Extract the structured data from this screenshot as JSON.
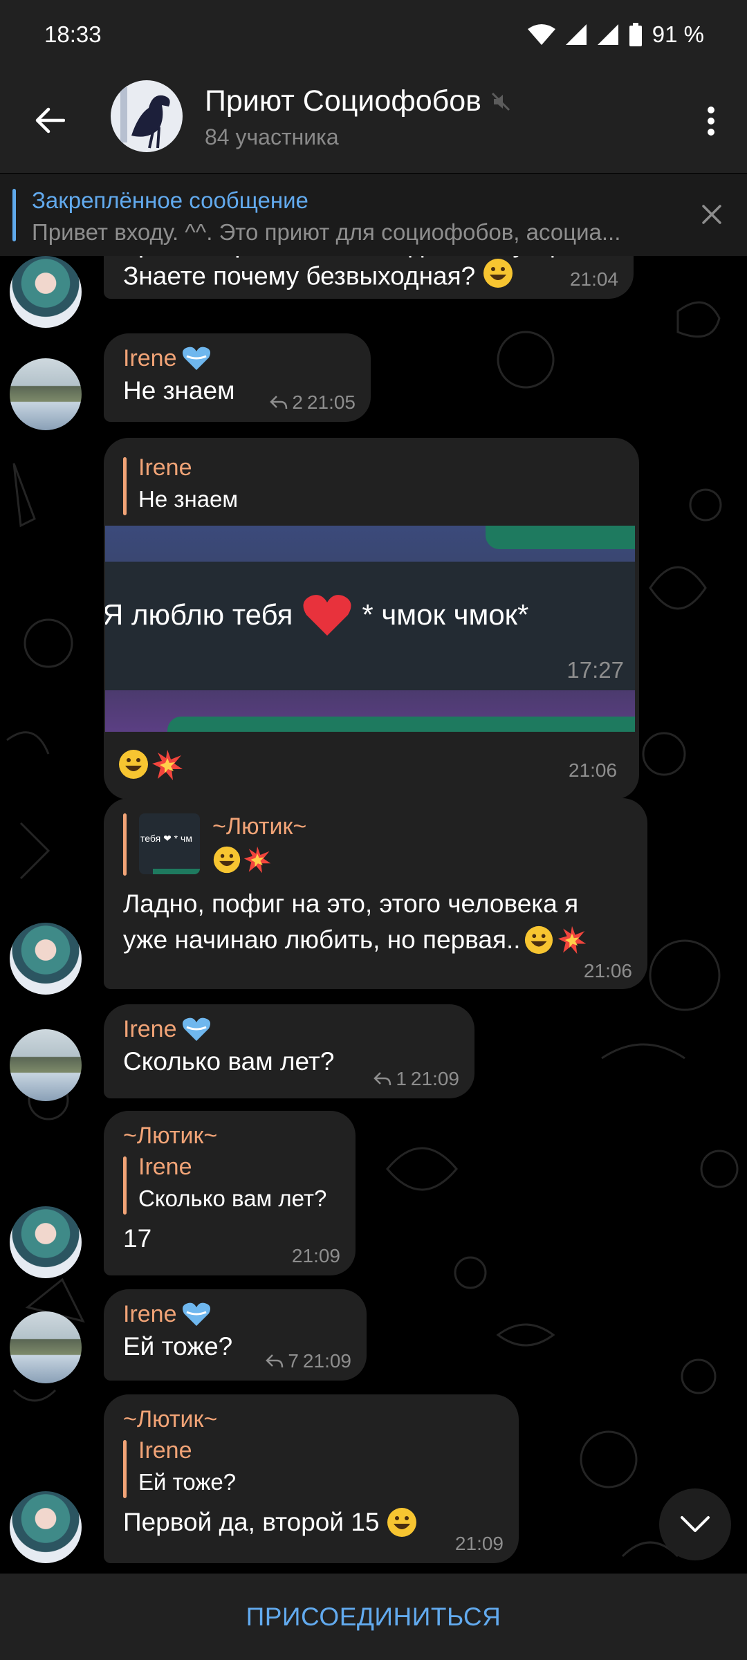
{
  "status_bar": {
    "time": "18:33",
    "battery": "91 %"
  },
  "header": {
    "title": "Приют Социофобов",
    "subtitle": "84 участника"
  },
  "pinned": {
    "title": "Закреплённое сообщение",
    "text": "Привет входу. ^^. Это приют для социофобов, асоциа..."
  },
  "messages": {
    "m1": {
      "partial_text": "Ура, теперь я в безвыходной ситуации",
      "text": "Знаете почему безвыходная?",
      "time": "21:04"
    },
    "m2": {
      "name": "Irene",
      "text": "Не знаем",
      "replies": "2",
      "time": "21:05"
    },
    "m3": {
      "reply_name": "Irene",
      "reply_text": "Не знаем",
      "image_text": "Я люблю тебя",
      "image_text_2": "* чмок чмок*",
      "image_time": "17:27",
      "time": "21:06"
    },
    "m4": {
      "reply_name": "~Лютик~",
      "reply_thumb_text": "тебя ❤ * чм",
      "line1": "Ладно, пофиг на это, этого человека я",
      "line2": "уже начинаю любить, но первая..",
      "time": "21:06"
    },
    "m5": {
      "name": "Irene",
      "text": "Сколько вам лет?",
      "replies": "1",
      "time": "21:09"
    },
    "m6": {
      "name": "~Лютик~",
      "reply_name": "Irene",
      "reply_text": "Сколько вам лет?",
      "text": "17",
      "time": "21:09"
    },
    "m7": {
      "name": "Irene",
      "text": "Ей тоже?",
      "replies": "7",
      "time": "21:09"
    },
    "m8": {
      "name": "~Лютик~",
      "reply_name": "Irene",
      "reply_text": "Ей тоже?",
      "text": "Первой да, второй 15",
      "time": "21:09"
    }
  },
  "join_label": "ПРИСОЕДИНИТЬСЯ",
  "colors": {
    "accent": "#62aaee",
    "name": "#f2a477",
    "bubble": "#212121"
  }
}
